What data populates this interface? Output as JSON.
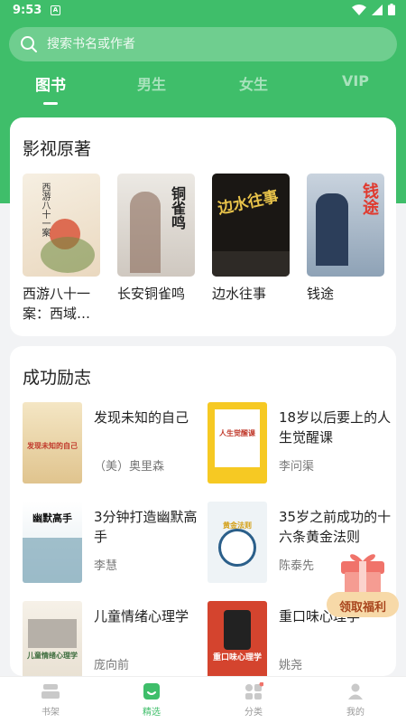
{
  "status": {
    "time": "9:53",
    "sim_label": "A"
  },
  "search": {
    "placeholder": "搜索书名或作者"
  },
  "tabs": [
    {
      "label": "图书",
      "active": true
    },
    {
      "label": "男生"
    },
    {
      "label": "女生"
    },
    {
      "label": "VIP"
    }
  ],
  "section_adaptations": {
    "title": "影视原著",
    "books": [
      {
        "title": "西游八十一案：西域…",
        "cover_text": "西游八十一案"
      },
      {
        "title": "长安铜雀鸣",
        "cover_text": "铜雀鸣"
      },
      {
        "title": "边水往事",
        "cover_text": "边水往事"
      },
      {
        "title": "钱途",
        "cover_text": "钱途"
      }
    ]
  },
  "section_inspiration": {
    "title": "成功励志",
    "books": [
      {
        "title": "发现未知的自己",
        "author": "（美）奥里森",
        "cover_text": "发现未知的自己"
      },
      {
        "title": "18岁以后要上的人生觉醒课",
        "author": "李问渠",
        "cover_text": "人生觉醒课"
      },
      {
        "title": "3分钟打造幽默高手",
        "author": "李慧",
        "cover_text": "幽默高手"
      },
      {
        "title": "35岁之前成功的十六条黄金法则",
        "author": "陈泰先",
        "cover_text": "黄金法则"
      },
      {
        "title": "儿童情绪心理学",
        "author": "庞向前",
        "cover_text": "儿童情绪心理学"
      },
      {
        "title": "重口味心理学",
        "author": "姚尧",
        "cover_text": "重口味心理学"
      }
    ]
  },
  "gift": {
    "label": "领取福利"
  },
  "bottom_nav": [
    {
      "label": "书架"
    },
    {
      "label": "精选",
      "active": true
    },
    {
      "label": "分类"
    },
    {
      "label": "我的"
    }
  ],
  "colors": {
    "accent": "#3fbe6a",
    "text": "#222222",
    "muted": "#777777"
  }
}
